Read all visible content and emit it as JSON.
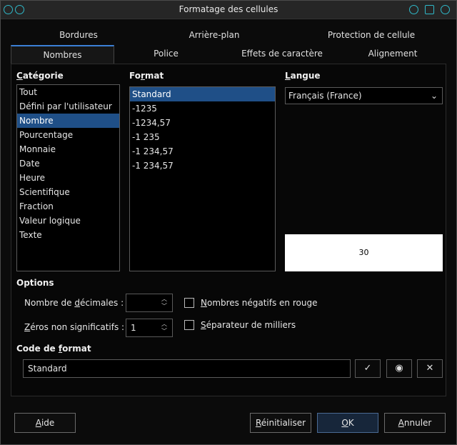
{
  "window": {
    "title": "Formatage des cellules"
  },
  "tabs_top": [
    "Bordures",
    "Arrière-plan",
    "Protection de cellule"
  ],
  "tabs_bottom": [
    "Nombres",
    "Police",
    "Effets de caractère",
    "Alignement"
  ],
  "category": {
    "label": "Catégorie",
    "items": [
      "Tout",
      "Défini par l'utilisateur",
      "Nombre",
      "Pourcentage",
      "Monnaie",
      "Date",
      "Heure",
      "Scientifique",
      "Fraction",
      "Valeur logique",
      "Texte"
    ],
    "selected": "Nombre"
  },
  "format": {
    "label": "Format",
    "items": [
      "Standard",
      "-1235",
      "-1234,57",
      "-1 235",
      "-1 234,57",
      "-1 234,57"
    ],
    "selected": "Standard"
  },
  "language": {
    "label": "Langue",
    "value": "Français (France)"
  },
  "preview": {
    "value": "30"
  },
  "options": {
    "label": "Options",
    "decimals_label": "Nombre de décimales :",
    "decimals_value": "",
    "leading_zeros_label": "Zéros non significatifs :",
    "leading_zeros_value": "1",
    "negative_red_label": "Nombres négatifs en rouge",
    "negative_red_checked": false,
    "thousands_sep_label": "Séparateur de milliers",
    "thousands_sep_checked": false
  },
  "format_code": {
    "label": "Code de format",
    "value": "Standard"
  },
  "buttons": {
    "help": "Aide",
    "reset": "Réinitialiser",
    "ok": "OK",
    "cancel": "Annuler"
  },
  "colors": {
    "accent": "#2fb9c9",
    "selection": "#1f4f87",
    "tab_indicator": "#3b7fd6"
  }
}
